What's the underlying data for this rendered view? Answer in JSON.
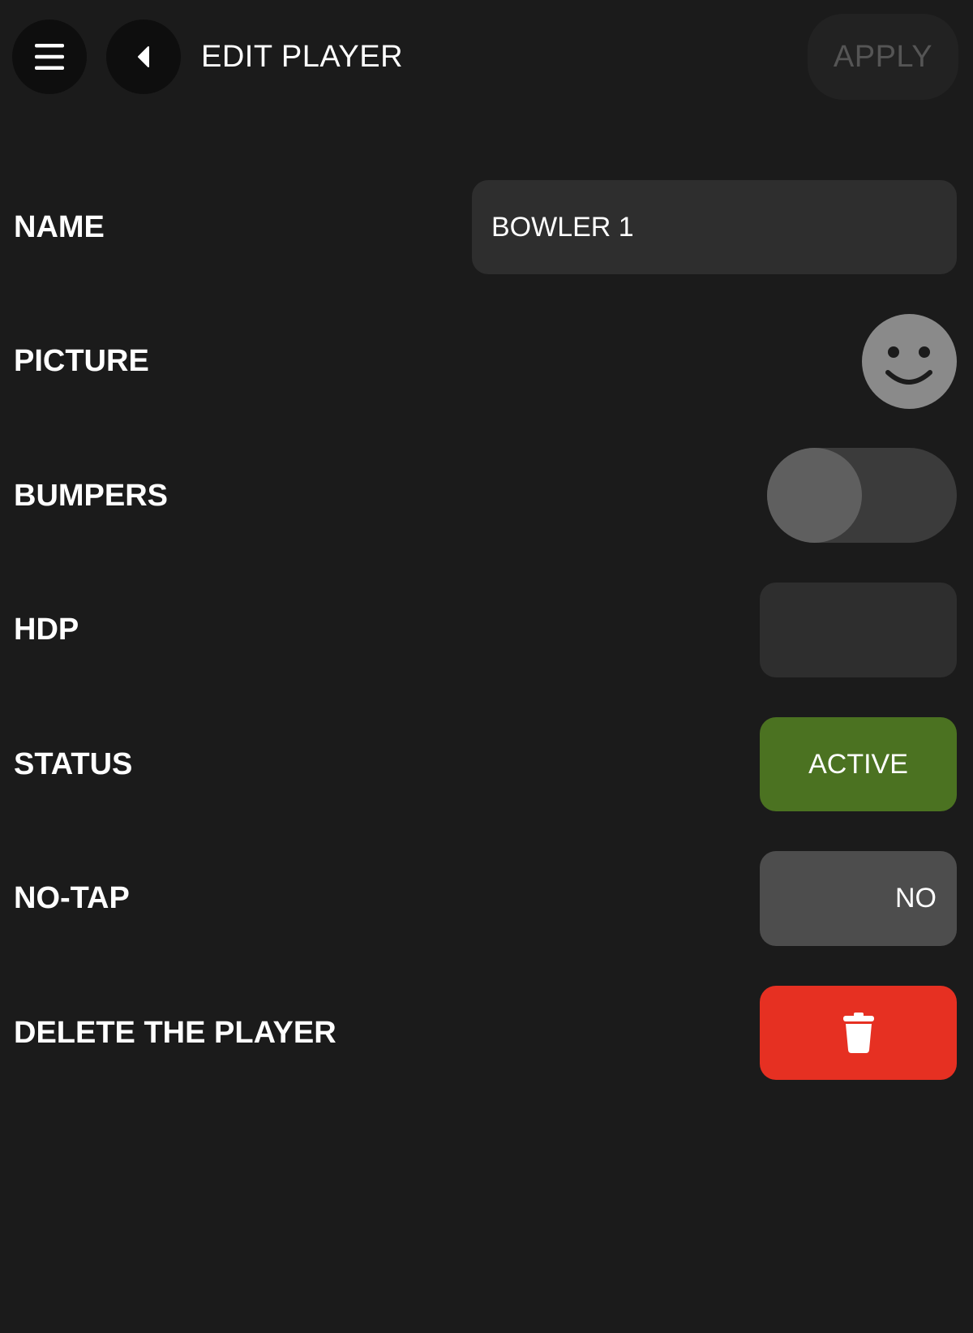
{
  "header": {
    "menu_icon": "hamburger-menu-icon",
    "back_icon": "caret-left-icon",
    "title": "EDIT PLAYER",
    "apply_label": "APPLY"
  },
  "form": {
    "name": {
      "label": "NAME",
      "value": "BOWLER 1"
    },
    "picture": {
      "label": "PICTURE",
      "icon": "smiley-face-icon"
    },
    "bumpers": {
      "label": "BUMPERS",
      "on": false
    },
    "hdp": {
      "label": "HDP",
      "value": ""
    },
    "status": {
      "label": "STATUS",
      "value": "ACTIVE",
      "color": "#4b7221"
    },
    "no_tap": {
      "label": "NO-TAP",
      "value": "NO"
    },
    "delete": {
      "label": "DELETE THE PLAYER",
      "icon": "trash-icon",
      "color": "#e63022"
    }
  },
  "colors": {
    "background": "#1b1b1b",
    "field": "#2e2e2e",
    "apply_disabled_text": "#555555"
  }
}
